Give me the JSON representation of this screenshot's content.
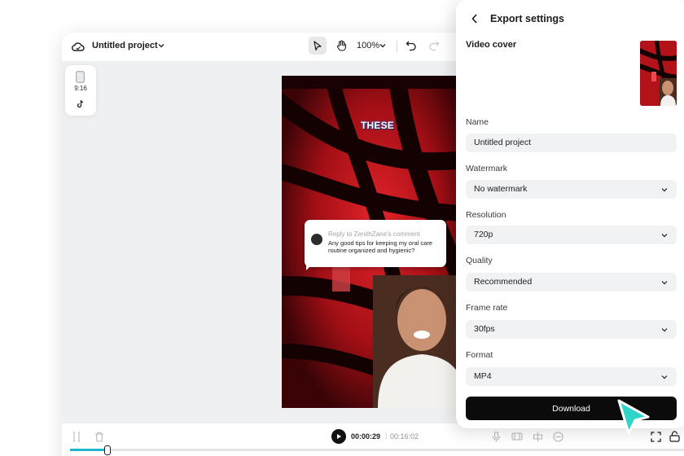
{
  "editor": {
    "project_title": "Untitled project",
    "zoom": "100%",
    "aspect_ratio": "9:16",
    "caption_text": "THESE",
    "comment": {
      "reply_to": "Reply to ZenithZane's comment",
      "text": "Any good tips for keeping my oral care routine organized and hygienic?"
    }
  },
  "timeline": {
    "current_time": "00:00:29",
    "separator": "|",
    "total_time": "00:16:02",
    "progress_fraction": 0.06
  },
  "export_panel": {
    "title": "Export settings",
    "video_cover_label": "Video cover",
    "fields": {
      "name": {
        "label": "Name",
        "value": "Untitled project"
      },
      "watermark": {
        "label": "Watermark",
        "value": "No watermark"
      },
      "resolution": {
        "label": "Resolution",
        "value": "720p"
      },
      "quality": {
        "label": "Quality",
        "value": "Recommended"
      },
      "frame_rate": {
        "label": "Frame rate",
        "value": "30fps"
      },
      "format": {
        "label": "Format",
        "value": "MP4"
      }
    },
    "download_label": "Download"
  },
  "colors": {
    "accent": "#21b5cf",
    "video_red": "#c0141a",
    "download_bg": "#0b0b0b",
    "cursor": "#2fd6c8"
  },
  "icons": [
    "cloud-icon",
    "chevron-down-icon",
    "pointer-icon",
    "hand-icon",
    "undo-icon",
    "redo-icon",
    "phone-icon",
    "tiktok-icon",
    "back-icon",
    "split-icon",
    "trash-icon",
    "play-icon",
    "mic-icon",
    "filmstrip-icon",
    "align-icon",
    "zoom-out-icon",
    "fullscreen-icon",
    "lock-icon",
    "cursor-icon"
  ]
}
